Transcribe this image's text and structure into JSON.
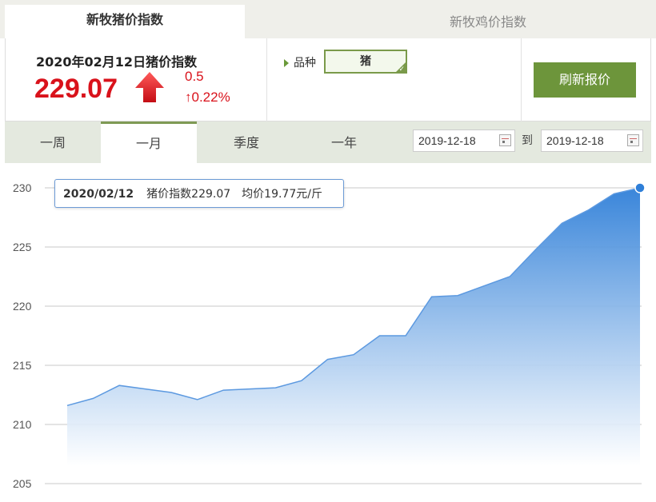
{
  "top_tabs": {
    "active": "新牧猪价指数",
    "inactive": "新牧鸡价指数"
  },
  "index_card": {
    "date_label": "2020年02月12日猪价指数",
    "value": "229.07",
    "change": "0.5",
    "change_pct": "↑0.22%",
    "direction_icon": "up-arrow-icon"
  },
  "variety": {
    "label": "品种",
    "selected": "猪"
  },
  "refresh_label": "刷新报价",
  "period_tabs": [
    "一周",
    "一月",
    "季度",
    "一年"
  ],
  "active_period": "一月",
  "date_range": {
    "from": "2019-12-18",
    "to_label": "到",
    "to": "2019-12-18"
  },
  "tooltip": {
    "date": "2020/02/12",
    "index_text": "猪价指数229.07",
    "avg_text": "均价19.77元/斤"
  },
  "colors": {
    "accent_green": "#6d953b",
    "price_red": "#d9121b",
    "series_blue": "#2f7fd8"
  },
  "chart_data": {
    "type": "area",
    "title": "",
    "xlabel": "",
    "ylabel": "",
    "ylim": [
      205,
      230
    ],
    "yticks": [
      230,
      225,
      220,
      215,
      210,
      205
    ],
    "grid": true,
    "series": [
      {
        "values": [
          211.6,
          212.2,
          213.3,
          213.0,
          212.7,
          212.1,
          212.9,
          213.0,
          213.1,
          213.7,
          215.5,
          215.9,
          217.5,
          217.5,
          220.8,
          220.9,
          221.7,
          222.5,
          224.8,
          227.0,
          228.1,
          229.5,
          230.0
        ]
      }
    ],
    "highlight_last_point": true
  }
}
